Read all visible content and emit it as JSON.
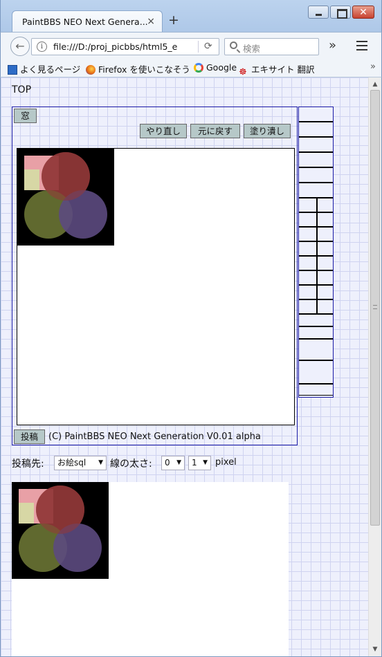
{
  "browser": {
    "tab_title": "PaintBBS NEO Next Genera...",
    "tab_close": "×",
    "new_tab": "+",
    "url": "file:///D:/proj_picbbs/html5_e",
    "search_placeholder": "検索",
    "overflow": "»",
    "bookmarks_more": "»",
    "bookmarks": [
      {
        "label": "よく見るページ",
        "icon": "bookmark-icon"
      },
      {
        "label": "Firefox を使いこなそう",
        "icon": "firefox-icon"
      },
      {
        "label": "Google",
        "icon": "google-icon"
      },
      {
        "label": "エキサイト 翻訳",
        "icon": "excite-icon"
      }
    ]
  },
  "page": {
    "top_link": "TOP",
    "window_button": "窓",
    "redo_button": "やり直し",
    "undo_button": "元に戻す",
    "fill_button": "塗り潰し",
    "post_button": "投稿",
    "copyright": "(C) PaintBBS NEO Next Generation V0.01 alpha",
    "destination_label": "投稿先:",
    "destination_value": "お絵sql",
    "line_width_label": "線の太さ:",
    "line_width_a": "0",
    "line_width_b": "1",
    "unit": "pixel"
  },
  "colors": {
    "canvas_bg": "#000000",
    "square": "#e8a0a6",
    "square_left": "#d4e0a4",
    "circle_red": "#8a3434",
    "circle_olive": "#6a7434",
    "circle_purple": "#5c4a80",
    "frame_border": "#1a1aa6"
  }
}
